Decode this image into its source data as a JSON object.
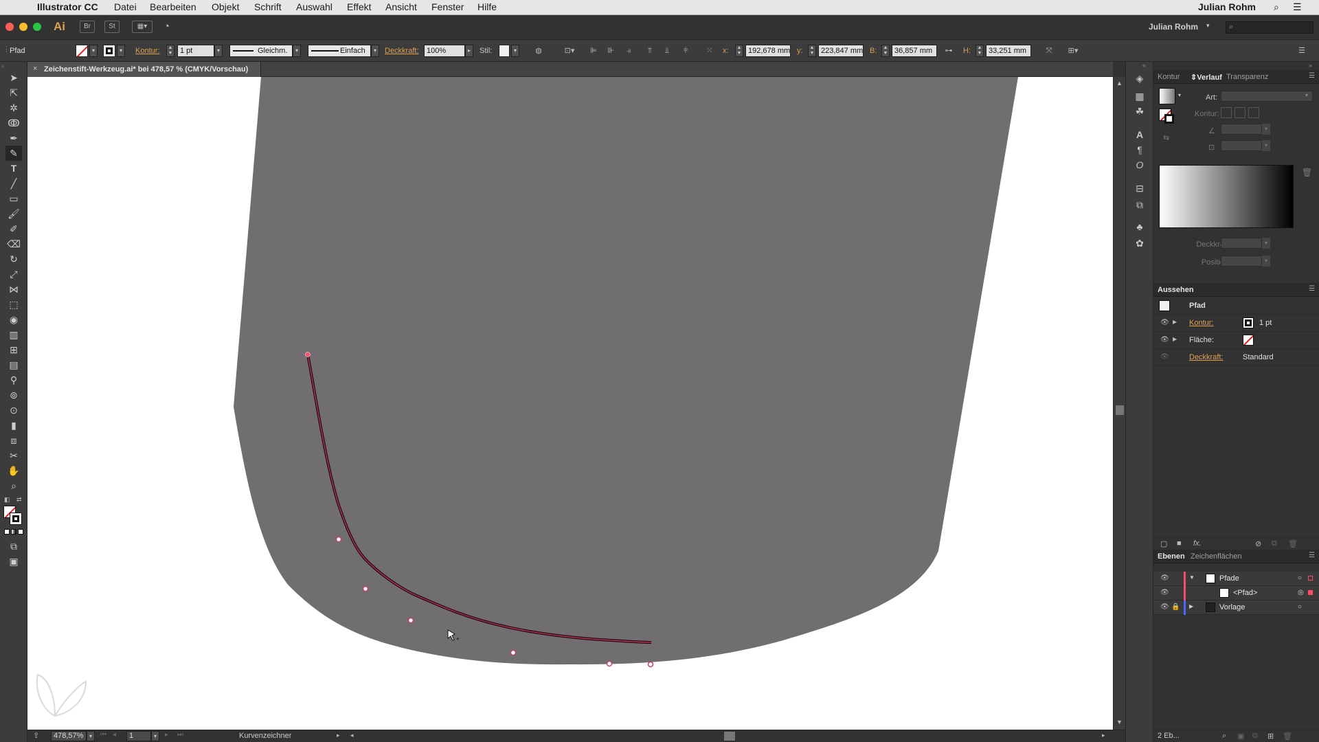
{
  "menubar": {
    "apple": "",
    "app_name": "Illustrator CC",
    "menus": [
      "Datei",
      "Bearbeiten",
      "Objekt",
      "Schrift",
      "Auswahl",
      "Effekt",
      "Ansicht",
      "Fenster",
      "Hilfe"
    ],
    "user": "Julian Rohm"
  },
  "appbar": {
    "logo": "Ai",
    "bridge": "Br",
    "stock": "St",
    "workspace_user": "Julian Rohm"
  },
  "control": {
    "selection_type": "Pfad",
    "kontur_label": "Kontur:",
    "kontur_value": "1 pt",
    "profile_value": "Gleichm.",
    "brush_value": "Einfach",
    "deckkraft_label": "Deckkraft:",
    "deckkraft_value": "100%",
    "stil_label": "Stil:",
    "x_label": "x:",
    "x_value": "192,678 mm",
    "y_label": "y:",
    "y_value": "223,847 mm",
    "b_label": "B:",
    "b_value": "36,857 mm",
    "h_label": "H:",
    "h_value": "33,251 mm"
  },
  "document": {
    "tab_title": "Zeichenstift-Werkzeug.ai* bei 478,57 % (CMYK/Vorschau)",
    "shape_color": "#706e70",
    "path_color": "#8b1a2e"
  },
  "status": {
    "zoom": "478,57%",
    "page": "1",
    "tool_name": "Kurvenzeichner"
  },
  "gradient_panel": {
    "tabs": [
      "Kontur",
      "Verlauf",
      "Transparenz"
    ],
    "active_tab": "Verlauf",
    "art_label": "Art:",
    "kontur_label": "Kontur:",
    "deckkraft_label": "Deckkraft:",
    "position_label": "Position:"
  },
  "appearance_panel": {
    "title": "Aussehen",
    "object": "Pfad",
    "rows": [
      {
        "label": "Kontur:",
        "value": "1 pt"
      },
      {
        "label": "Fläche:",
        "value": ""
      },
      {
        "label": "Deckkraft:",
        "value": "Standard"
      }
    ],
    "fx_label": "fx."
  },
  "layers_panel": {
    "tabs": [
      "Ebenen",
      "Zeichenflächen"
    ],
    "active_tab": "Ebenen",
    "layers": [
      {
        "name": "Pfade",
        "color": "#ff4a6a",
        "expanded": true
      },
      {
        "name": "<Pfad>",
        "color": "#ff4a6a",
        "expanded": false
      },
      {
        "name": "Vorlage",
        "color": "#4a6aff",
        "expanded": false
      }
    ],
    "footer": "2 Eb..."
  },
  "colors": {
    "accent_orange": "#e0a050",
    "panel_bg": "#323232",
    "selection_red": "#ff4a6a"
  }
}
